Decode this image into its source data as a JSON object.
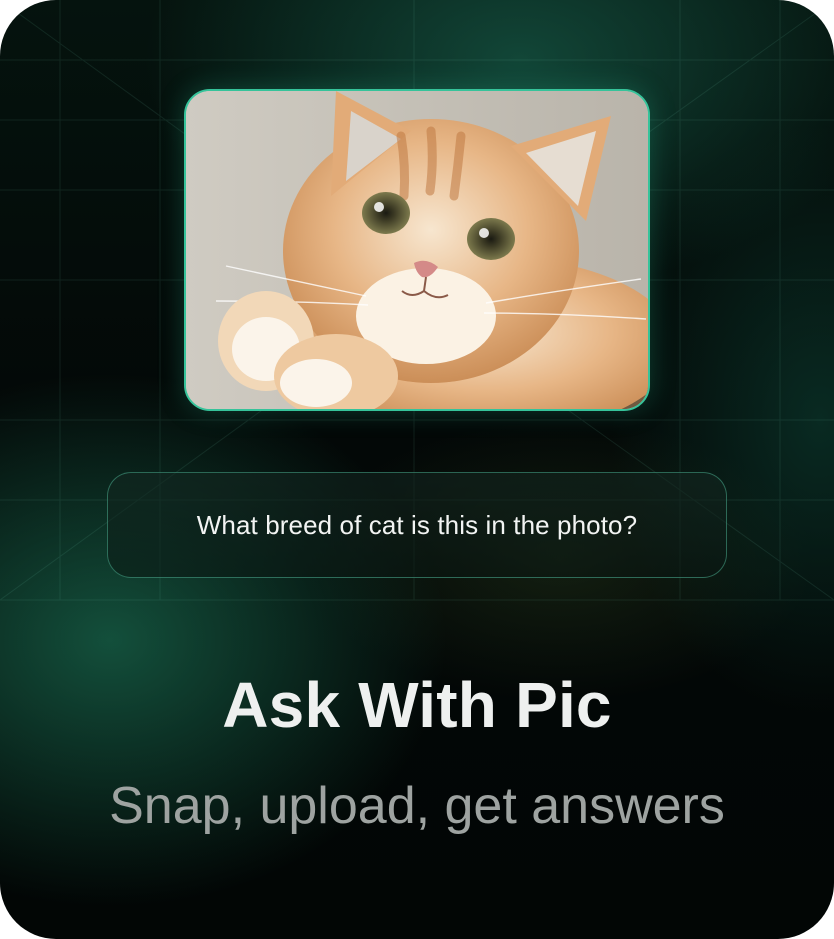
{
  "card": {
    "question": "What breed of cat is this in the photo?",
    "title": "Ask With Pic",
    "subtitle": "Snap, upload, get answers"
  },
  "colors": {
    "accent": "#36c39a",
    "background": "#030807",
    "title": "#eef0ef",
    "subtitle": "#9ea3a1"
  },
  "photo": {
    "subject": "cat-photo"
  }
}
